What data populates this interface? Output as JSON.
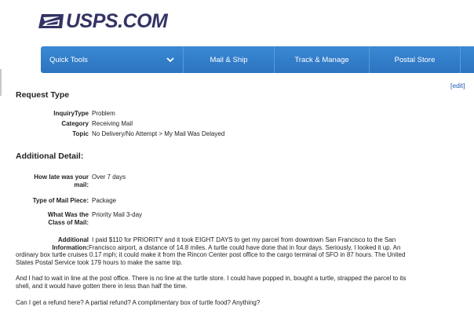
{
  "brand": {
    "logo_text": "USPS.COM",
    "brand_color": "#333366"
  },
  "nav": {
    "items": [
      {
        "label": "Quick Tools"
      },
      {
        "label": "Mail & Ship"
      },
      {
        "label": "Track & Manage"
      },
      {
        "label": "Postal Store"
      }
    ],
    "bar_color": "#2f7bc8"
  },
  "request": {
    "heading": "Request Type",
    "edit_label": "[edit]",
    "fields": [
      {
        "label": "InquiryType",
        "value": "Problem"
      },
      {
        "label": "Category",
        "value": "Receiving Mail"
      },
      {
        "label": "Topic",
        "value": "No Delivery/No Attempt > My Mail Was Delayed"
      }
    ]
  },
  "additional": {
    "heading": "Additional Detail:",
    "late_label_1": "How late was your",
    "late_label_2": "mail:",
    "late_value": "Over 7 days",
    "piece_label": "Type of Mail Piece:",
    "piece_value": "Package",
    "class_label_1": "What Was the",
    "class_label_2": "Class of Mail:",
    "class_value": "Priority Mail 3-day",
    "info_label_1": "Additional",
    "info_label_2": "Information:",
    "info_line_1": "I paid $110 for PRIORITY and it took EIGHT DAYS to get my parcel from downtown San Francisco to the San",
    "info_line_2": "Francisco airport, a distance of 14.8 miles.  A turtle could have done that in four days.  Seriously, I looked it up.  An",
    "info_line_3": "ordinary box turtle cruises 0.17 mph; it could make it from the Rincon Center post office to the cargo terminal of SFO in 87 hours. The United",
    "info_line_4": "States Postal Service took 179 hours to make the same trip.",
    "para2_line_1": "And I had to wait in line at the post office. There is no line at the turtle store.  I could have popped in, bought a turtle, strapped the parcel to its",
    "para2_line_2": "shell, and it would have gotten there in less than half the time.",
    "para3": "Can I get a refund here?  A partial refund?  A complimentary box of turtle food?  Anything?"
  }
}
